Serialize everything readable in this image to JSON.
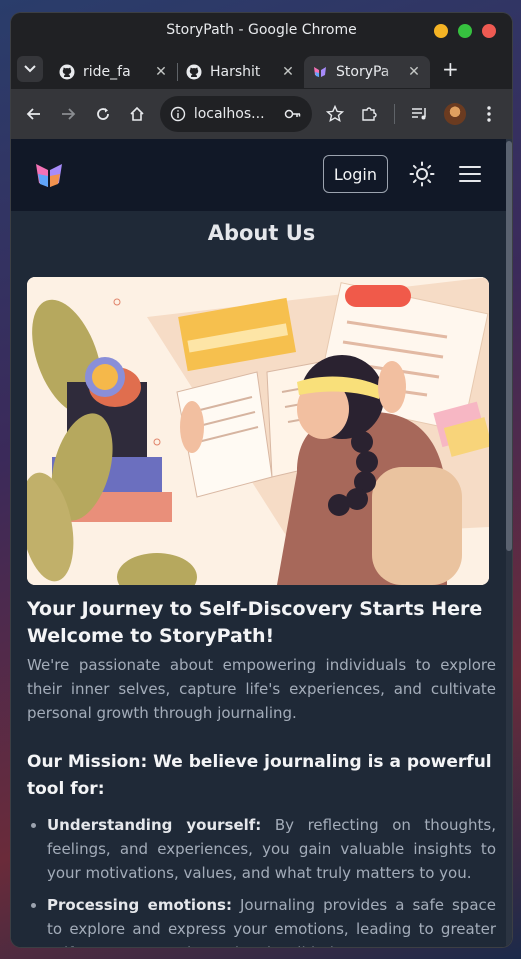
{
  "window": {
    "title": "StoryPath - Google Chrome"
  },
  "colors": {
    "close": "#ee5a52",
    "minimize": "#f4b324",
    "maximize": "#36c13f",
    "app_bg": "#1f2937",
    "nav_bg": "#111827"
  },
  "tabs": [
    {
      "label": "ride_fa",
      "icon": "github-icon"
    },
    {
      "label": "Harshit",
      "icon": "github-icon"
    },
    {
      "label": "StoryPa",
      "icon": "storypath-logo-icon"
    }
  ],
  "toolbar": {
    "url": "localhos..."
  },
  "nav": {
    "login_label": "Login"
  },
  "page": {
    "title": "About Us",
    "headline_1": "Your Journey to Self-Discovery Starts Here",
    "headline_2": "Welcome to StoryPath!",
    "lead": "We're passionate about empowering individuals to explore their inner selves, capture life's experiences, and cultivate personal growth through journaling.",
    "mission_heading": "Our Mission: We believe journaling is a powerful tool for:",
    "points": [
      {
        "term": "Understanding yourself:",
        "text": " By reflecting on thoughts, feelings, and experiences, you gain valuable insights to your motivations, values, and what truly matters to you."
      },
      {
        "term": "Processing emotions:",
        "text": " Journaling provides a safe space to explore and express your emotions, leading to greater self-awareness and emotional well-being."
      }
    ]
  }
}
